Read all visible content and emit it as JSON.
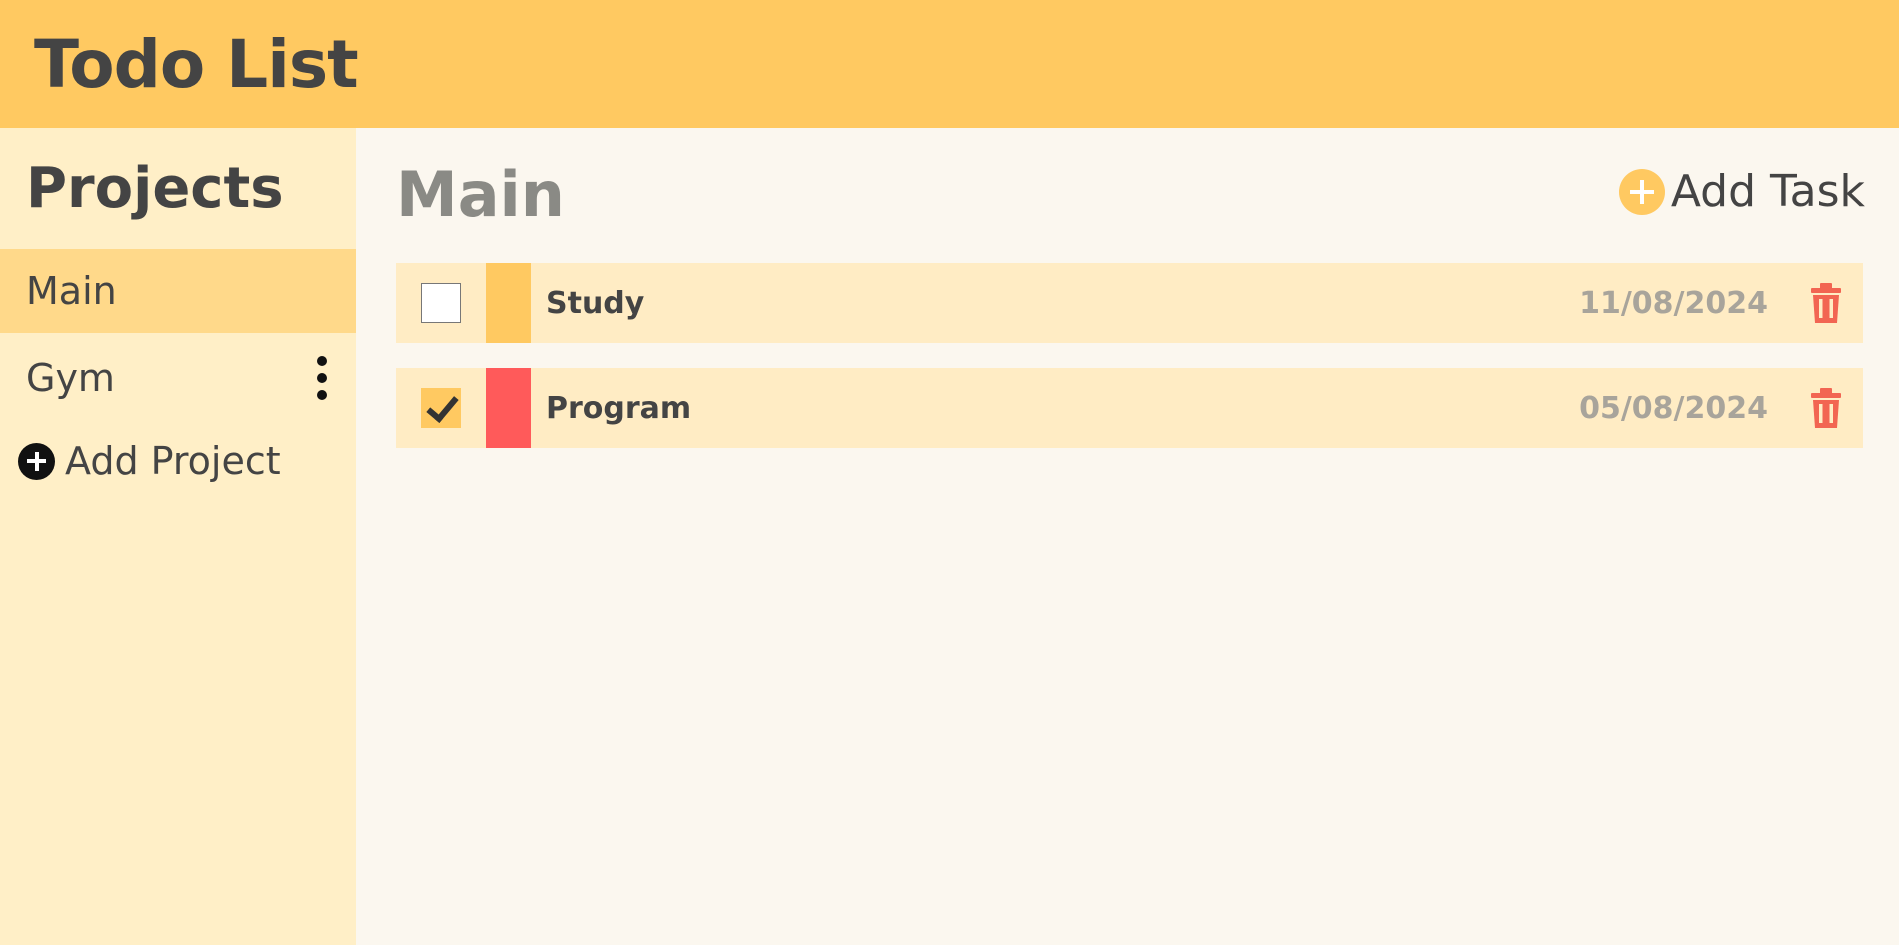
{
  "app": {
    "title": "Todo List"
  },
  "sidebar": {
    "heading": "Projects",
    "projects": [
      {
        "label": "Main",
        "active": true
      },
      {
        "label": "Gym",
        "active": false,
        "menu_icon": "kebab-menu-icon"
      }
    ],
    "add_project_label": "Add Project",
    "add_project_icon": "plus-circle-icon"
  },
  "main": {
    "title": "Main",
    "add_task_label": "Add Task",
    "add_task_icon": "plus-circle-icon",
    "tasks": [
      {
        "name": "Study",
        "date": "11/08/2024",
        "completed": false,
        "priority_color": "#ffc961",
        "delete_icon": "trash-icon"
      },
      {
        "name": "Program",
        "date": "05/08/2024",
        "completed": true,
        "priority_color": "#ff5a5a",
        "delete_icon": "trash-icon"
      }
    ]
  },
  "colors": {
    "header_bg": "#ffc961",
    "sidebar_bg": "#ffefc7",
    "active_project_bg": "#ffd98a",
    "main_bg": "#fbf7ef",
    "task_bg": "#ffecc4",
    "delete_red": "#f26552"
  }
}
